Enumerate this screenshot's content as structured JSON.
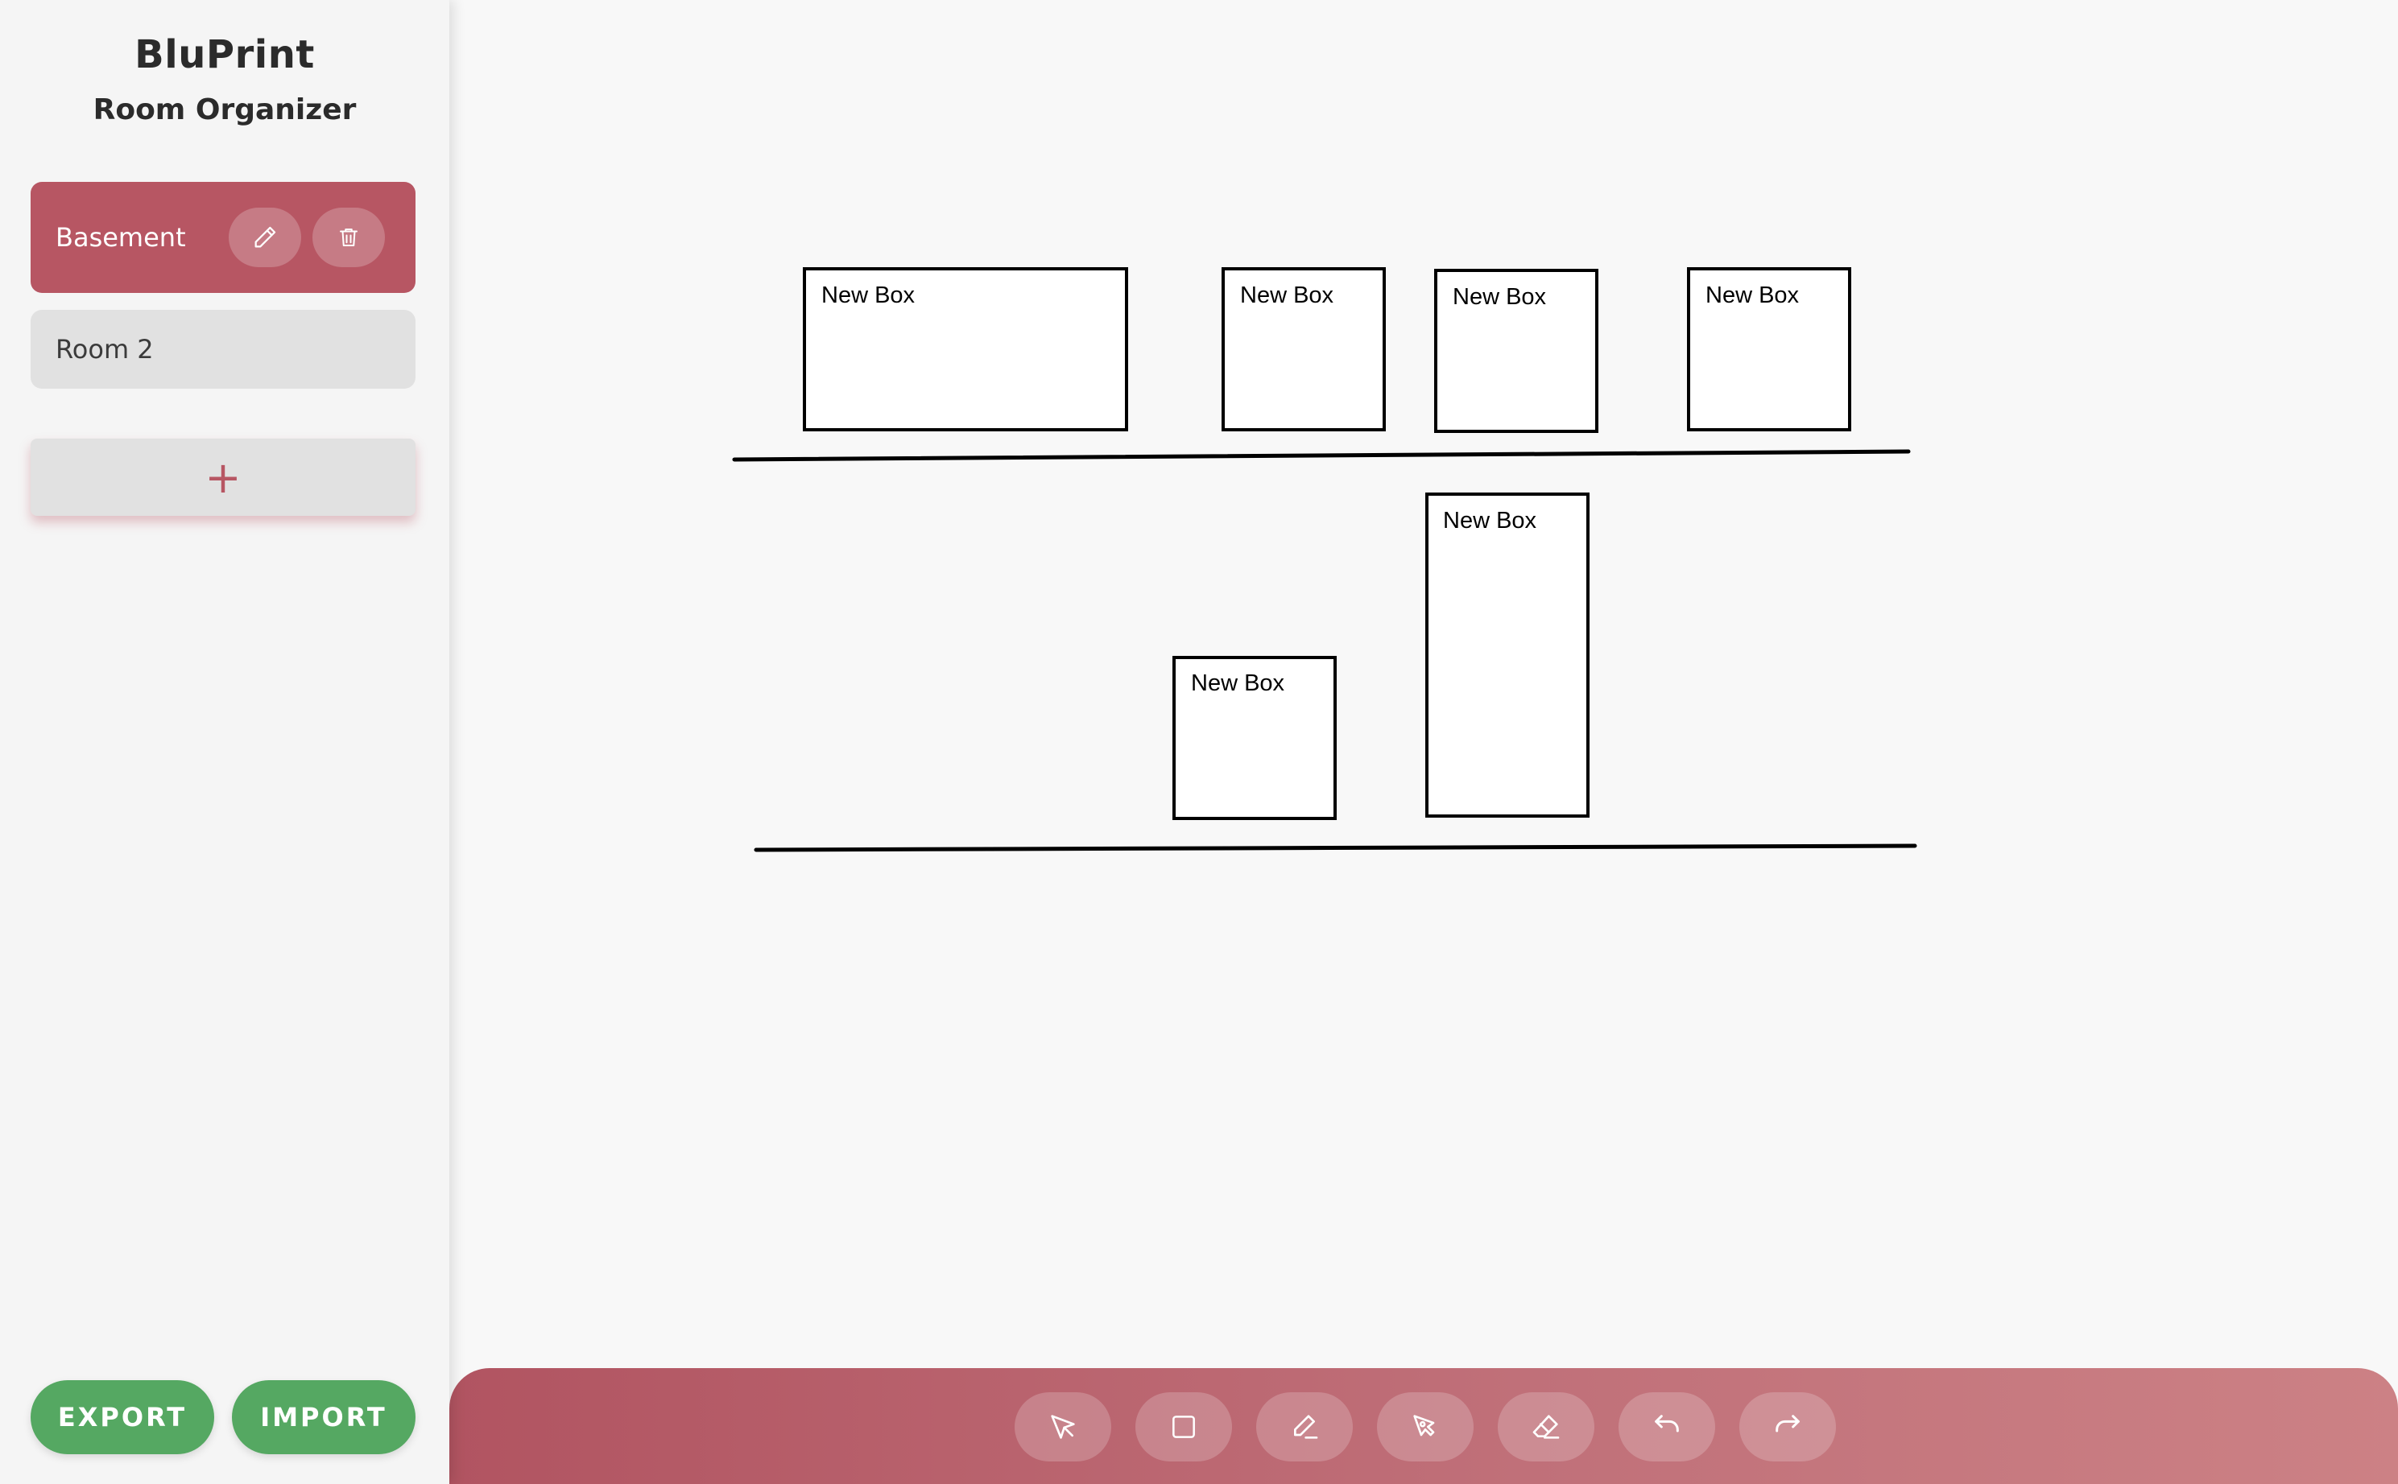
{
  "app": {
    "title": "BluPrint",
    "subtitle": "Room Organizer"
  },
  "rooms": [
    {
      "label": "Basement",
      "active": true
    },
    {
      "label": "Room 2",
      "active": false
    }
  ],
  "sidebar": {
    "add_room_symbol": "+",
    "export_label": "EXPORT",
    "import_label": "IMPORT"
  },
  "canvas": {
    "box_label": "New Box",
    "boxes": [
      "New Box",
      "New Box",
      "New Box",
      "New Box",
      "New Box",
      "New Box"
    ]
  },
  "toolbar": {
    "tools": [
      "select-tool",
      "rectangle-tool",
      "pencil-tool",
      "pen-tool",
      "eraser-tool",
      "undo",
      "redo"
    ]
  },
  "colors": {
    "accent": "#b75663",
    "green": "#55a862",
    "inactive_room": "#e1e1e1",
    "background": "#f8f8f8"
  }
}
